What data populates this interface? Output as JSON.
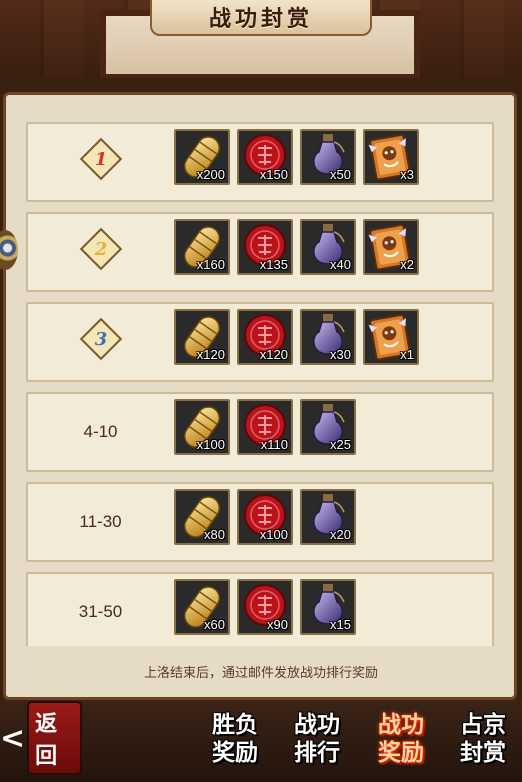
{
  "header": {
    "title": "战功封赏"
  },
  "rows": [
    {
      "rank": "1",
      "rank_style": "red",
      "items": [
        {
          "icon": "gold-ingot-icon",
          "count": "x200"
        },
        {
          "icon": "red-seal-icon",
          "count": "x150"
        },
        {
          "icon": "purple-gourd-icon",
          "count": "x50"
        },
        {
          "icon": "dragon-tile-icon",
          "count": "x3"
        }
      ]
    },
    {
      "rank": "2",
      "rank_style": "gold",
      "items": [
        {
          "icon": "gold-ingot-icon",
          "count": "x160"
        },
        {
          "icon": "red-seal-icon",
          "count": "x135"
        },
        {
          "icon": "purple-gourd-icon",
          "count": "x40"
        },
        {
          "icon": "dragon-tile-icon",
          "count": "x2"
        }
      ]
    },
    {
      "rank": "3",
      "rank_style": "blue",
      "items": [
        {
          "icon": "gold-ingot-icon",
          "count": "x120"
        },
        {
          "icon": "red-seal-icon",
          "count": "x120"
        },
        {
          "icon": "purple-gourd-icon",
          "count": "x30"
        },
        {
          "icon": "dragon-tile-icon",
          "count": "x1"
        }
      ]
    },
    {
      "rank": "4-10",
      "items": [
        {
          "icon": "gold-ingot-icon",
          "count": "x100"
        },
        {
          "icon": "red-seal-icon",
          "count": "x110"
        },
        {
          "icon": "purple-gourd-icon",
          "count": "x25"
        }
      ]
    },
    {
      "rank": "11-30",
      "items": [
        {
          "icon": "gold-ingot-icon",
          "count": "x80"
        },
        {
          "icon": "red-seal-icon",
          "count": "x100"
        },
        {
          "icon": "purple-gourd-icon",
          "count": "x20"
        }
      ]
    },
    {
      "rank": "31-50",
      "items": [
        {
          "icon": "gold-ingot-icon",
          "count": "x60"
        },
        {
          "icon": "red-seal-icon",
          "count": "x90"
        },
        {
          "icon": "purple-gourd-icon",
          "count": "x15"
        }
      ]
    }
  ],
  "footer": {
    "note": "上洛结束后，通过邮件发放战功排行奖励"
  },
  "nav": {
    "back_label": "返回",
    "tabs": [
      {
        "label": "胜负奖励",
        "active": false
      },
      {
        "label": "战功排行",
        "active": false
      },
      {
        "label": "战功奖励",
        "active": true
      },
      {
        "label": "占京封赏",
        "active": false
      }
    ]
  },
  "colors": {
    "rank_red": "#d8352a",
    "rank_gold": "#e2b23a",
    "rank_blue": "#3f6fb0",
    "row_bg": "#f2ebd8",
    "panel_bg": "#e6dcc5"
  }
}
